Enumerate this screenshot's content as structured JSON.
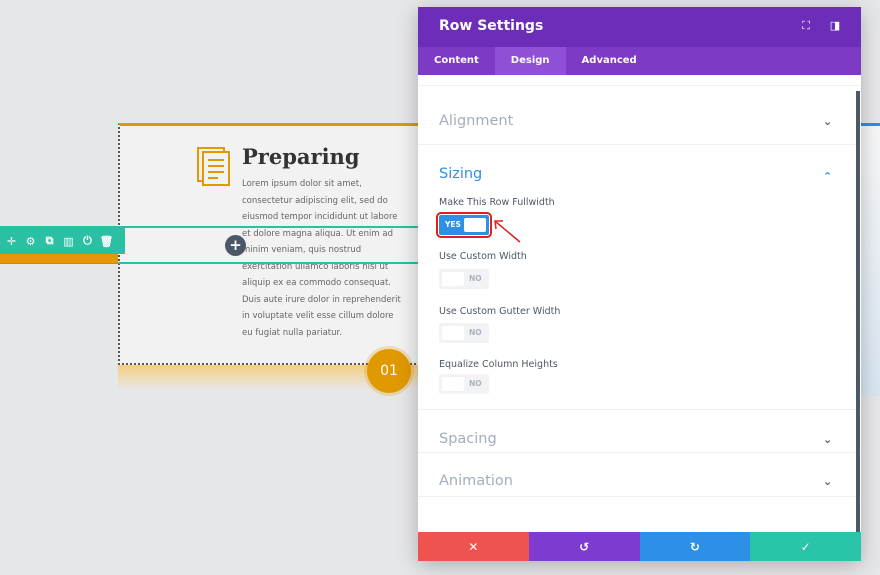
{
  "builder": {
    "title": "Preparing",
    "body": "Lorem ipsum dolor sit amet, consectetur adipiscing elit, sed do eiusmod tempor incididunt ut labore et dolore magna aliqua. Ut enim ad minim veniam, quis nostrud exercitation ullamco laboris nisi ut aliquip ex ea commodo consequat. Duis aute irure dolor in reprehenderit in voluptate velit esse cillum dolore eu fugiat nulla pariatur.",
    "badge": "01",
    "add_label": "+",
    "toolbar_icons": [
      "move-icon",
      "gear-icon",
      "duplicate-icon",
      "columns-icon",
      "power-icon",
      "trash-icon"
    ],
    "accent_teal": "#2bbfa3",
    "accent_gold": "#e09900"
  },
  "modal": {
    "title": "Row Settings",
    "tabs": [
      {
        "label": "Content",
        "active": false
      },
      {
        "label": "Design",
        "active": true
      },
      {
        "label": "Advanced",
        "active": false
      }
    ],
    "sections": {
      "alignment": "Alignment",
      "sizing": "Sizing",
      "spacing": "Spacing",
      "animation": "Animation"
    },
    "fields": {
      "fullwidth_label": "Make This Row Fullwidth",
      "fullwidth_value": "YES",
      "custom_width_label": "Use Custom Width",
      "custom_width_value": "NO",
      "gutter_label": "Use Custom Gutter Width",
      "gutter_value": "NO",
      "equalize_label": "Equalize Column Heights",
      "equalize_value": "NO"
    },
    "footer": {
      "cancel": "✕",
      "undo": "↺",
      "redo": "↻",
      "save": "✓"
    },
    "colors": {
      "header": "#6c2eb9",
      "tabs": "#7d3ac5",
      "cancel": "#ef5350",
      "undo": "#7e3bd0",
      "redo": "#2e8fe6",
      "save": "#29c4a9"
    }
  }
}
